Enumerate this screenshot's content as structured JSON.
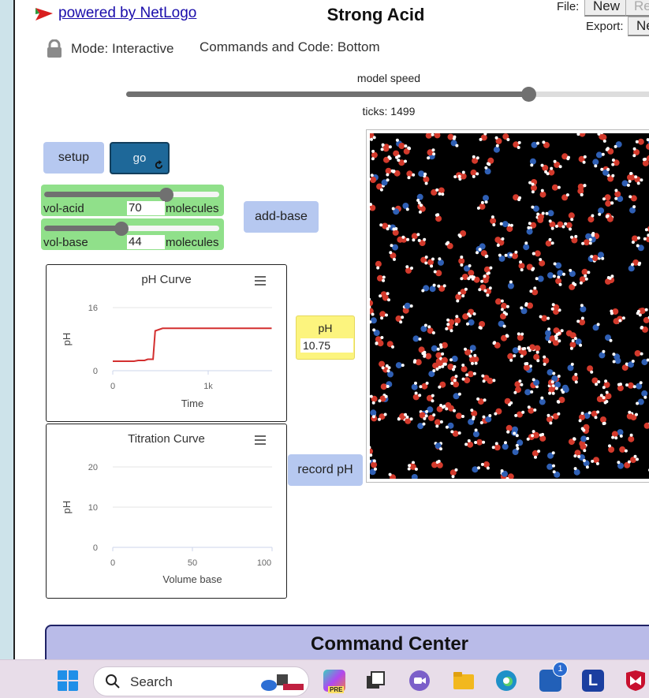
{
  "header": {
    "link_text": "powered by NetLogo",
    "title": "Strong Acid",
    "file_label": "File:",
    "file_new": "New",
    "file_revert": "Re",
    "export_label": "Export:",
    "export_first": "Ne",
    "mode_text": "Mode: Interactive",
    "code_position": "Commands and Code: Bottom"
  },
  "speed": {
    "label": "model speed",
    "value_fraction": 0.75,
    "ticks_text": "ticks: 1499"
  },
  "buttons": {
    "setup": "setup",
    "go": "go",
    "add_base": "add-base",
    "record_ph": "record pH"
  },
  "sliders": [
    {
      "name": "vol-acid",
      "value": "70",
      "units": "molecules",
      "fraction": 0.7
    },
    {
      "name": "vol-base",
      "value": "44",
      "units": "molecules",
      "fraction": 0.44
    }
  ],
  "monitor": {
    "label": "pH",
    "value": "10.75"
  },
  "plots": {
    "ph_curve": {
      "title": "pH Curve",
      "ylabel": "pH",
      "xlabel": "Time",
      "yticks": [
        "16",
        "0"
      ],
      "xticks": [
        "0",
        "1k"
      ]
    },
    "titration": {
      "title": "Titration Curve",
      "ylabel": "pH",
      "xlabel": "Volume base",
      "yticks": [
        "20",
        "10",
        "0"
      ],
      "xticks": [
        "0",
        "50",
        "100"
      ]
    }
  },
  "command_center": {
    "title": "Command Center"
  },
  "taskbar": {
    "search_placeholder": "Search",
    "badge_count": "1",
    "pre_tag": "PRE",
    "l_icon": "L"
  },
  "colors": {
    "acid": "#d33a2c",
    "base": "#2f5fb4",
    "water_h": "#ffffff",
    "slider_bg": "#90e08a",
    "button": "#b6c8f0",
    "monitor": "#fcf47e"
  },
  "chart_data": [
    {
      "type": "line",
      "title": "pH Curve",
      "xlabel": "Time",
      "ylabel": "pH",
      "xlim": [
        0,
        1500
      ],
      "ylim": [
        0,
        16
      ],
      "grid": true,
      "series": [
        {
          "x": [
            0,
            200,
            240,
            300,
            330,
            380,
            400,
            470,
            1499
          ],
          "y": [
            2.4,
            2.4,
            2.6,
            2.6,
            2.9,
            2.9,
            10.1,
            10.75,
            10.75
          ]
        }
      ]
    },
    {
      "type": "line",
      "title": "Titration Curve",
      "xlabel": "Volume base",
      "ylabel": "pH",
      "xlim": [
        0,
        100
      ],
      "ylim": [
        0,
        20
      ],
      "grid": true,
      "series": []
    }
  ]
}
